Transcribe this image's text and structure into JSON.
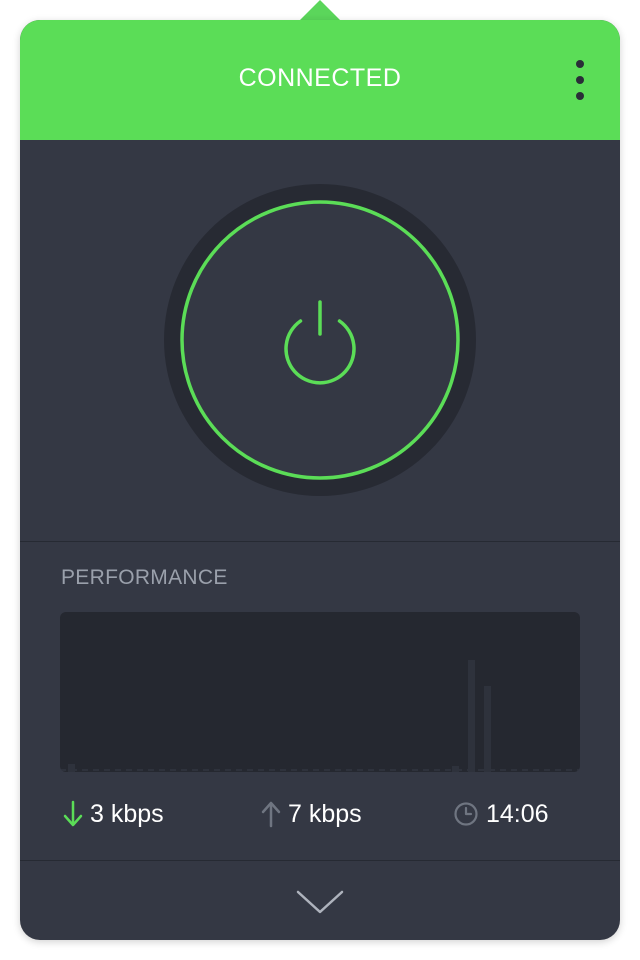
{
  "header": {
    "status": "CONNECTED",
    "menu_icon": "more-vertical-icon"
  },
  "connection": {
    "power_icon": "power-icon",
    "state": "connected"
  },
  "performance": {
    "label": "PERFORMANCE",
    "graph_type": "bar"
  },
  "stats": {
    "download_icon": "arrow-down-icon",
    "download": "3 kbps",
    "upload_icon": "arrow-up-icon",
    "upload": "7 kbps",
    "time_icon": "clock-icon",
    "time": "14:06"
  },
  "footer": {
    "expand_icon": "chevron-down-icon"
  },
  "colors": {
    "accent_green": "#5bdd57",
    "panel": "#343844",
    "graph_bg": "#252830",
    "muted_text": "#9aa0ab"
  }
}
